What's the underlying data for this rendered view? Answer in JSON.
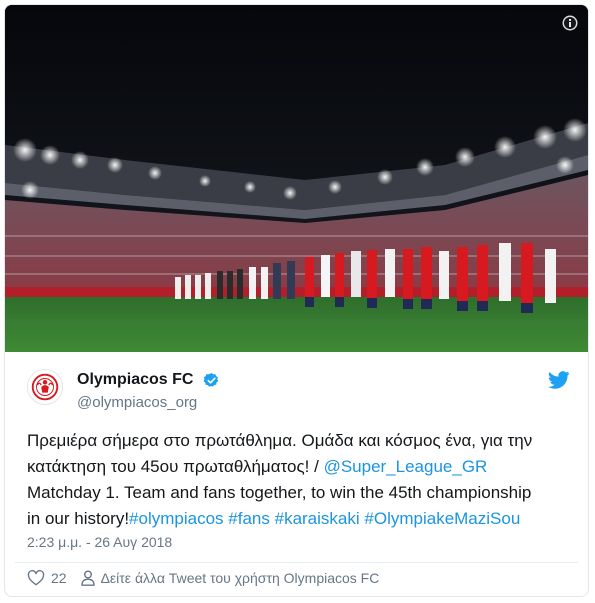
{
  "media": {
    "image_alt": "Olympiacos players and children line up on the pitch before the match at Karaiskakis stadium",
    "info_icon": "info-icon"
  },
  "author": {
    "display_name": "Olympiacos FC",
    "handle": "@olympiacos_org",
    "verified": true,
    "avatar_icon": "olympiacos-crest-icon"
  },
  "brand_icon": "twitter-bird-icon",
  "tweet": {
    "line1": "Πρεμιέρα σήμερα στο πρωτάθλημα. Ομάδα και κόσμος ένα, για την",
    "line2_text": "κατάκτηση του 45ου πρωταθλήματος! / ",
    "line2_mention": "@Super_League_GR",
    "line3": "Matchday 1. Team and fans together, to win the 45th championship",
    "line4_text": "in our history!",
    "hashtags": [
      "#olympiacos",
      "#fans",
      "#karaiskaki",
      "#OlympiakeMaziSou"
    ]
  },
  "timestamp": "2:23 μ.μ. - 26 Αυγ 2018",
  "actions": {
    "like_count": "22",
    "profile_link": "Δείτε άλλα Tweet του χρήστη Olympiacos FC"
  },
  "colors": {
    "link": "#1b95e0",
    "secondary_text": "#657786",
    "primary_text": "#14171a",
    "brand_red": "#d71920",
    "twitter_blue": "#1da1f2"
  }
}
